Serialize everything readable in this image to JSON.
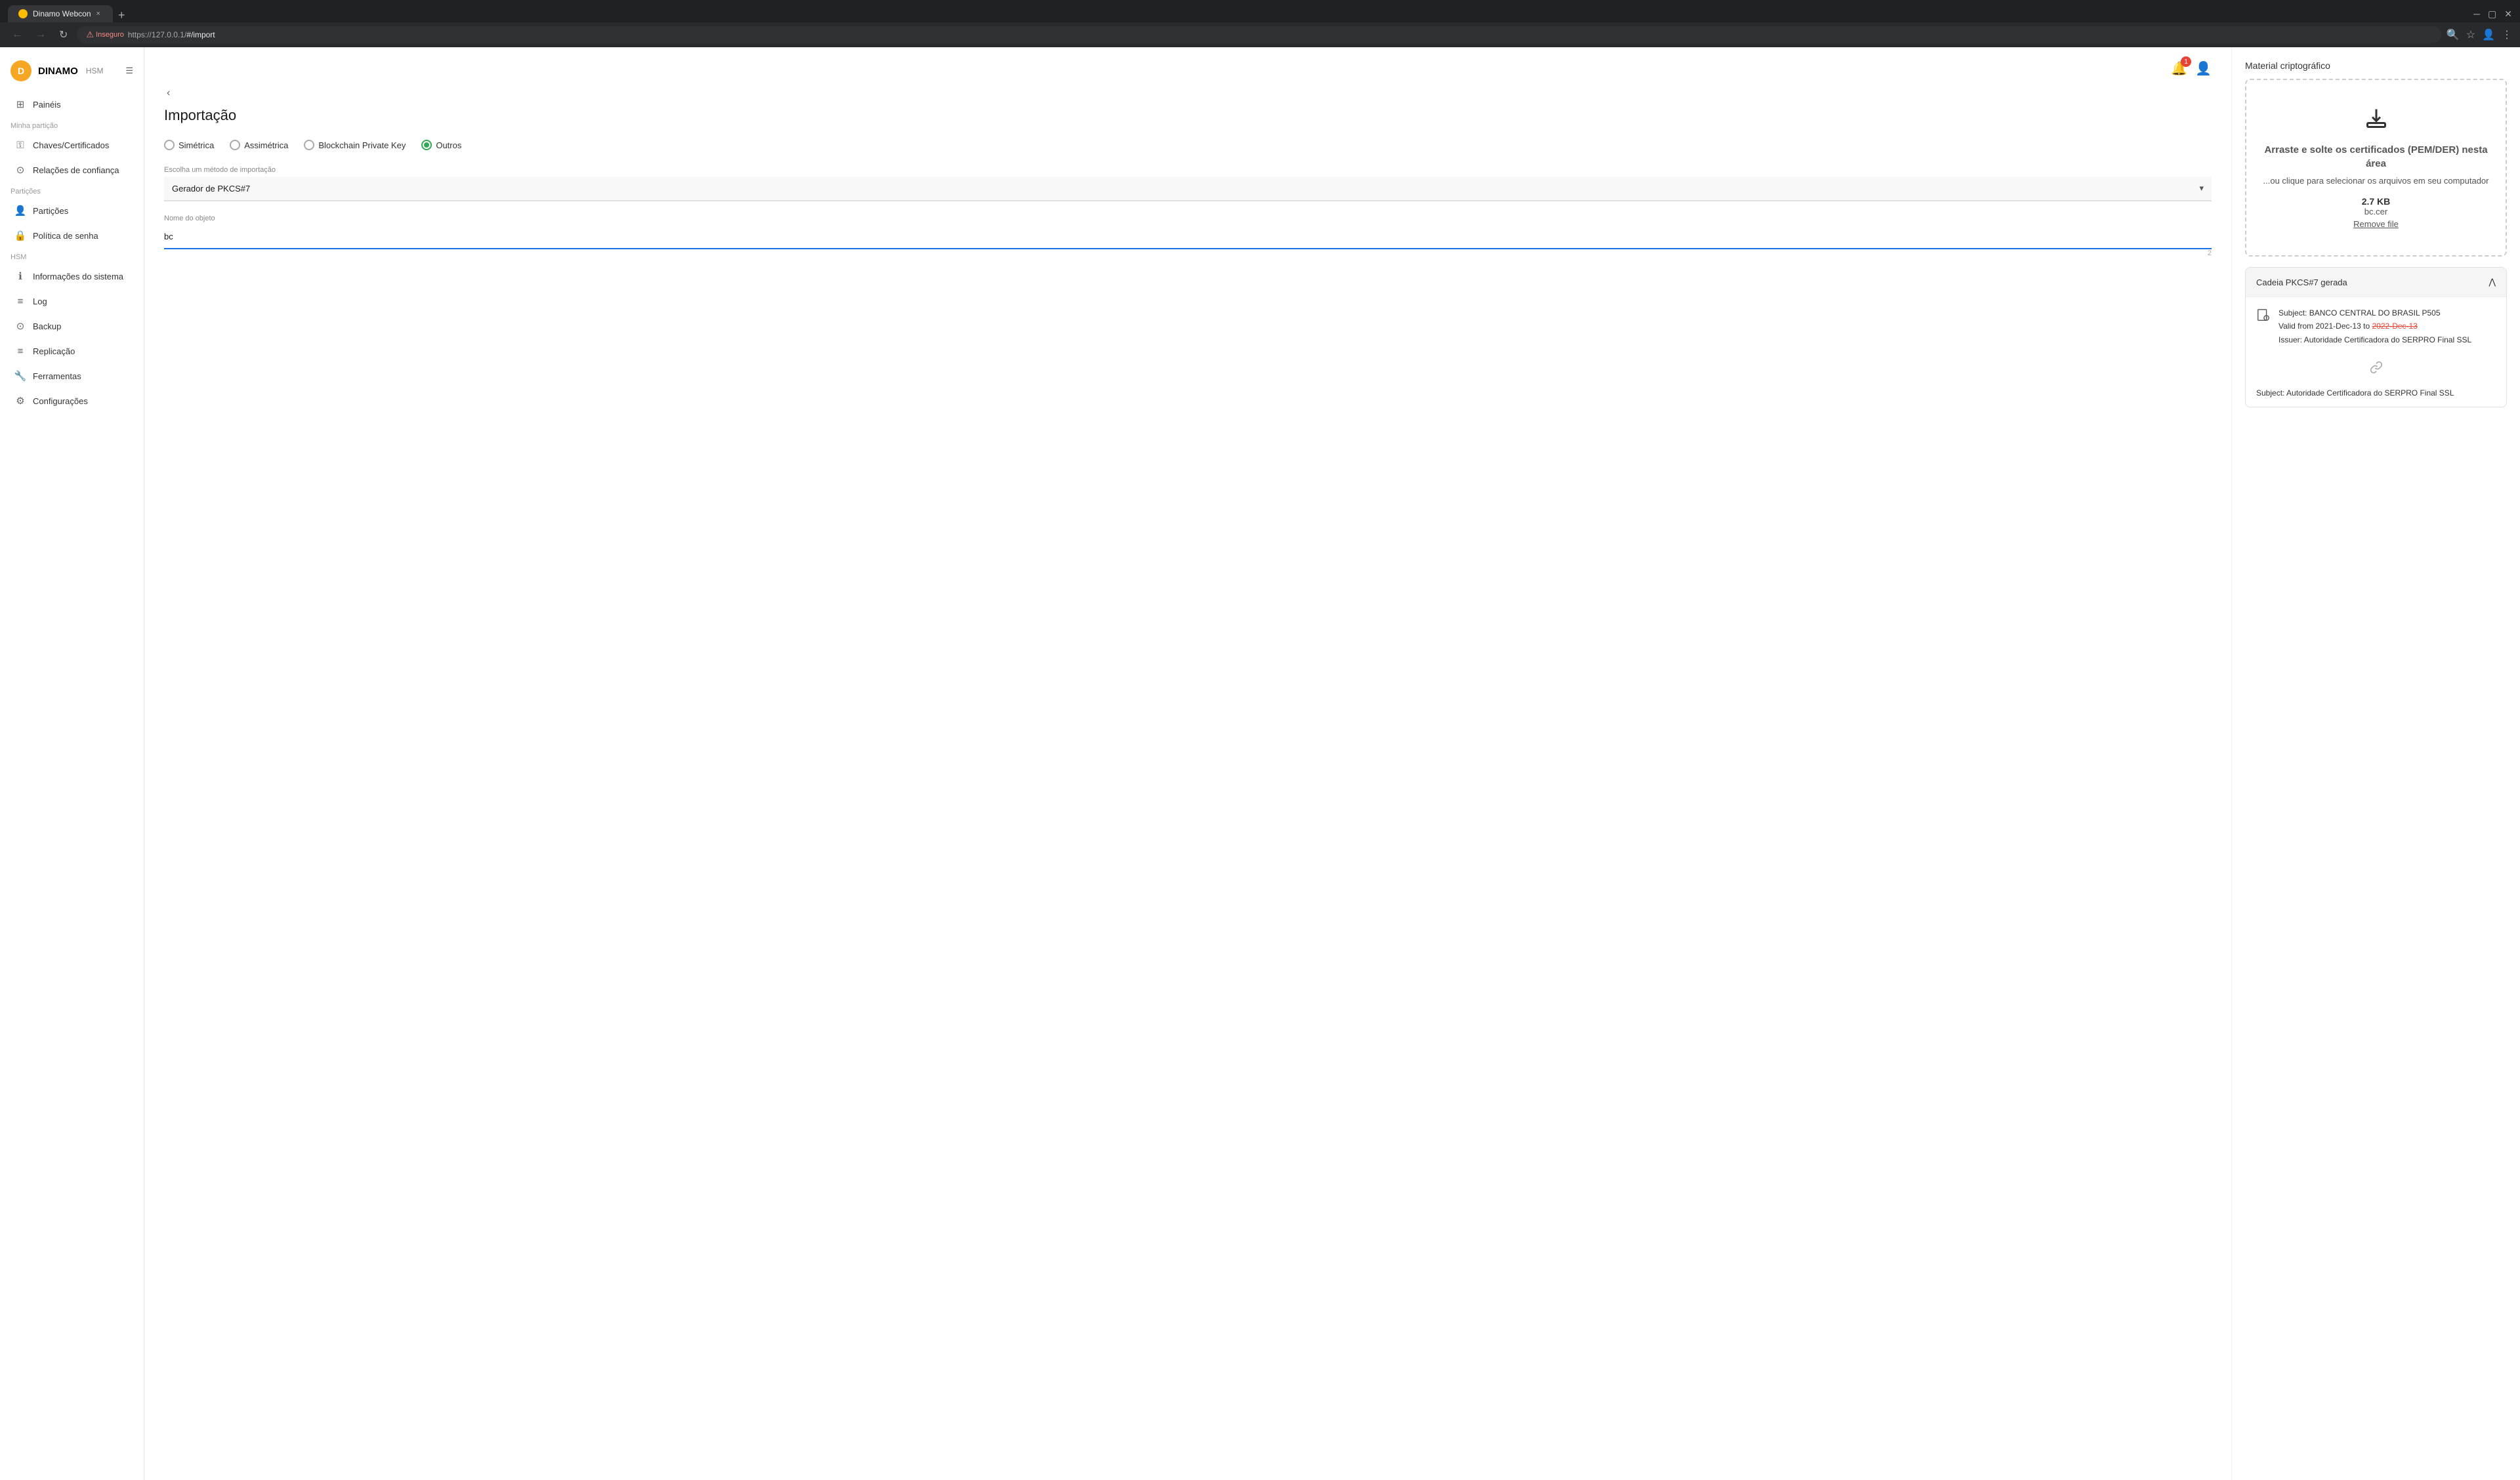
{
  "browser": {
    "tab_favicon_color": "#fbbc04",
    "tab_title": "Dinamo Webcon",
    "tab_close": "×",
    "tab_new": "+",
    "nav_back_disabled": true,
    "nav_forward_disabled": true,
    "url_insecure_label": "Inseguro",
    "url_full": "https://127.0.0.1/#/import",
    "url_base": "https://127.0.0.1/",
    "url_path": "#/import",
    "browser_actions": [
      "search",
      "star",
      "user",
      "menu"
    ]
  },
  "app": {
    "logo_text": "D",
    "title": "DINAMO",
    "subtitle": "HSM",
    "notification_count": "1"
  },
  "sidebar": {
    "section_minha_particao": "Minha partição",
    "section_particoes": "Partições",
    "section_hsm": "HSM",
    "items": [
      {
        "id": "paineis",
        "label": "Painéis",
        "icon": "⊞"
      },
      {
        "id": "chaves",
        "label": "Chaves/Certificados",
        "icon": "🔑"
      },
      {
        "id": "relacoes",
        "label": "Relações de confiança",
        "icon": "⊙"
      },
      {
        "id": "particoes",
        "label": "Partições",
        "icon": "👤"
      },
      {
        "id": "politica",
        "label": "Política de senha",
        "icon": "🔒"
      },
      {
        "id": "informacoes",
        "label": "Informações do sistema",
        "icon": "ℹ"
      },
      {
        "id": "log",
        "label": "Log",
        "icon": "≡"
      },
      {
        "id": "backup",
        "label": "Backup",
        "icon": "⊙"
      },
      {
        "id": "replicacao",
        "label": "Replicação",
        "icon": "≡"
      },
      {
        "id": "ferramentas",
        "label": "Ferramentas",
        "icon": "🔧"
      },
      {
        "id": "configuracoes",
        "label": "Configurações",
        "icon": "⚙"
      }
    ]
  },
  "page": {
    "collapse_icon": "‹",
    "title": "Importação",
    "radio_options": [
      {
        "id": "simetrica",
        "label": "Simétrica",
        "checked": false,
        "color": ""
      },
      {
        "id": "assimetrica",
        "label": "Assimétrica",
        "checked": false,
        "color": ""
      },
      {
        "id": "blockchain",
        "label": "Blockchain Private Key",
        "checked": false,
        "color": ""
      },
      {
        "id": "outros",
        "label": "Outros",
        "checked": true,
        "color": "green"
      }
    ],
    "import_method_label": "Escolha um método de importação",
    "import_method_value": "Gerador de PKCS#7",
    "object_name_label": "Nome do objeto",
    "object_name_value": "bc",
    "char_count": "2"
  },
  "right_panel": {
    "title": "Material criptográfico",
    "drop_title": "Arraste e solte os certificados (PEM/DER) nesta área",
    "drop_subtitle": "...ou clique para selecionar os arquivos em seu computador",
    "file_size": "2.7 KB",
    "file_name": "bc.cer",
    "remove_label": "Remove file",
    "chain_section_title": "Cadeia PKCS#7 gerada",
    "chain_items": [
      {
        "subject": "Subject: BANCO CENTRAL DO BRASIL P505",
        "valid_from": "Valid from 2021-Dec-13 to ",
        "valid_to_expired": "2022-Dec-13",
        "issuer": "Issuer: Autoridade Certificadora do SERPRO Final SSL"
      }
    ],
    "chain_next_subject": "Subject: Autoridade Certificadora do SERPRO Final SSL"
  }
}
